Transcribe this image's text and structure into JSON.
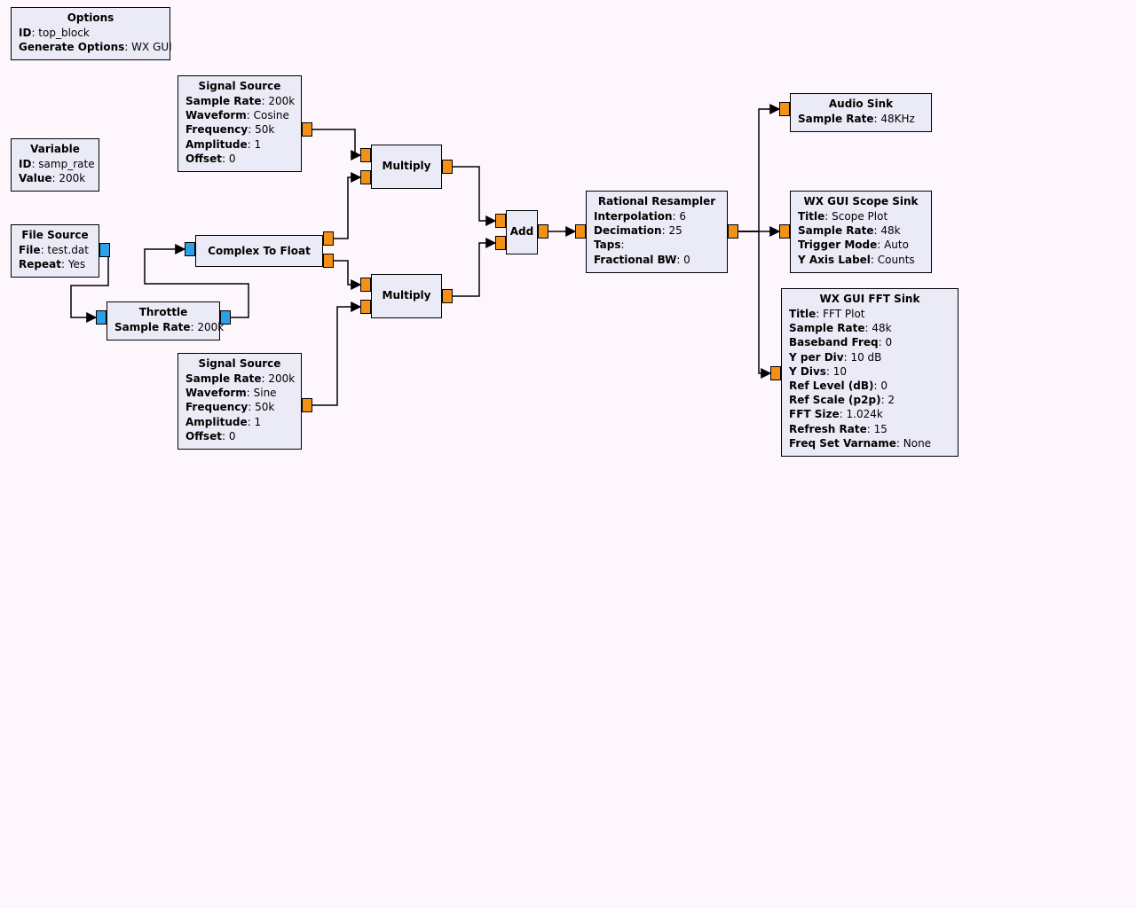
{
  "blocks": {
    "options": {
      "title": "Options",
      "params": [
        {
          "label": "ID",
          "value": "top_block"
        },
        {
          "label": "Generate Options",
          "value": "WX GUI"
        }
      ]
    },
    "variable": {
      "title": "Variable",
      "params": [
        {
          "label": "ID",
          "value": "samp_rate"
        },
        {
          "label": "Value",
          "value": "200k"
        }
      ]
    },
    "file_source": {
      "title": "File Source",
      "params": [
        {
          "label": "File",
          "value": "test.dat"
        },
        {
          "label": "Repeat",
          "value": "Yes"
        }
      ]
    },
    "throttle": {
      "title": "Throttle",
      "params": [
        {
          "label": "Sample Rate",
          "value": "200k"
        }
      ]
    },
    "sig_src_cos": {
      "title": "Signal Source",
      "params": [
        {
          "label": "Sample Rate",
          "value": "200k"
        },
        {
          "label": "Waveform",
          "value": "Cosine"
        },
        {
          "label": "Frequency",
          "value": "50k"
        },
        {
          "label": "Amplitude",
          "value": "1"
        },
        {
          "label": "Offset",
          "value": "0"
        }
      ]
    },
    "sig_src_sin": {
      "title": "Signal Source",
      "params": [
        {
          "label": "Sample Rate",
          "value": "200k"
        },
        {
          "label": "Waveform",
          "value": "Sine"
        },
        {
          "label": "Frequency",
          "value": "50k"
        },
        {
          "label": "Amplitude",
          "value": "1"
        },
        {
          "label": "Offset",
          "value": "0"
        }
      ]
    },
    "c2f": {
      "title": "Complex To Float"
    },
    "mult1": {
      "title": "Multiply"
    },
    "mult2": {
      "title": "Multiply"
    },
    "add": {
      "title": "Add"
    },
    "resampler": {
      "title": "Rational Resampler",
      "params": [
        {
          "label": "Interpolation",
          "value": "6"
        },
        {
          "label": "Decimation",
          "value": "25"
        },
        {
          "label": "Taps",
          "value": ""
        },
        {
          "label": "Fractional BW",
          "value": "0"
        }
      ]
    },
    "audio_sink": {
      "title": "Audio Sink",
      "params": [
        {
          "label": "Sample Rate",
          "value": "48KHz"
        }
      ]
    },
    "scope_sink": {
      "title": "WX GUI Scope Sink",
      "params": [
        {
          "label": "Title",
          "value": "Scope Plot"
        },
        {
          "label": "Sample Rate",
          "value": "48k"
        },
        {
          "label": "Trigger Mode",
          "value": "Auto"
        },
        {
          "label": "Y Axis Label",
          "value": "Counts"
        }
      ]
    },
    "fft_sink": {
      "title": "WX GUI FFT Sink",
      "params": [
        {
          "label": "Title",
          "value": "FFT Plot"
        },
        {
          "label": "Sample Rate",
          "value": "48k"
        },
        {
          "label": "Baseband Freq",
          "value": "0"
        },
        {
          "label": "Y per Div",
          "value": "10 dB"
        },
        {
          "label": "Y Divs",
          "value": "10"
        },
        {
          "label": "Ref Level (dB)",
          "value": "0"
        },
        {
          "label": "Ref Scale (p2p)",
          "value": "2"
        },
        {
          "label": "FFT Size",
          "value": "1.024k"
        },
        {
          "label": "Refresh Rate",
          "value": "15"
        },
        {
          "label": "Freq Set Varname",
          "value": "None"
        }
      ]
    }
  }
}
